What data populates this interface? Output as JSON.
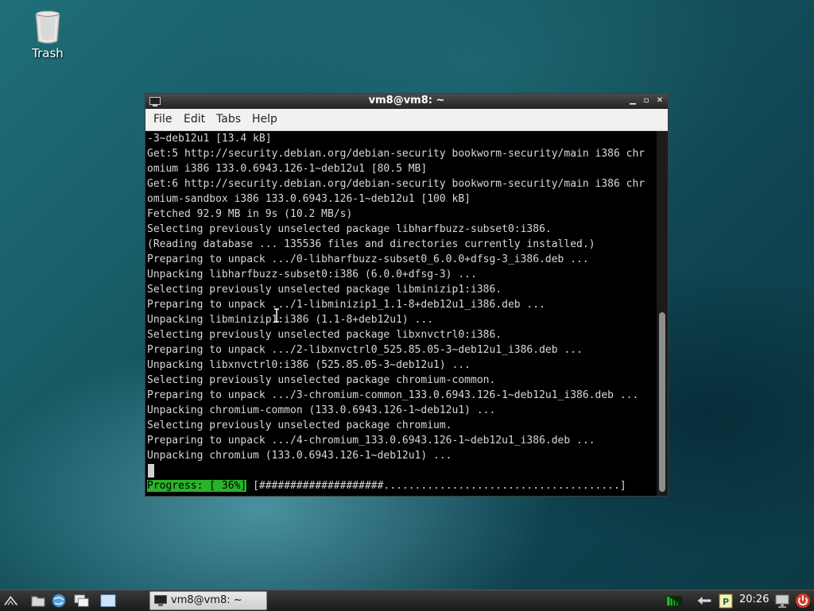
{
  "desktop": {
    "trash_label": "Trash"
  },
  "window": {
    "title": "vm8@vm8: ~",
    "menu": [
      "File",
      "Edit",
      "Tabs",
      "Help"
    ]
  },
  "terminal": {
    "lines": [
      "-3~deb12u1 [13.4 kB]",
      "Get:5 http://security.debian.org/debian-security bookworm-security/main i386 chr",
      "omium i386 133.0.6943.126-1~deb12u1 [80.5 MB]",
      "Get:6 http://security.debian.org/debian-security bookworm-security/main i386 chr",
      "omium-sandbox i386 133.0.6943.126-1~deb12u1 [100 kB]",
      "Fetched 92.9 MB in 9s (10.2 MB/s)",
      "Selecting previously unselected package libharfbuzz-subset0:i386.",
      "(Reading database ... 135536 files and directories currently installed.)",
      "Preparing to unpack .../0-libharfbuzz-subset0_6.0.0+dfsg-3_i386.deb ...",
      "Unpacking libharfbuzz-subset0:i386 (6.0.0+dfsg-3) ...",
      "Selecting previously unselected package libminizip1:i386.",
      "Preparing to unpack .../1-libminizip1_1.1-8+deb12u1_i386.deb ...",
      "Unpacking libminizip1:i386 (1.1-8+deb12u1) ...",
      "Selecting previously unselected package libxnvctrl0:i386.",
      "Preparing to unpack .../2-libxnvctrl0_525.85.05-3~deb12u1_i386.deb ...",
      "Unpacking libxnvctrl0:i386 (525.85.05-3~deb12u1) ...",
      "Selecting previously unselected package chromium-common.",
      "Preparing to unpack .../3-chromium-common_133.0.6943.126-1~deb12u1_i386.deb ...",
      "Unpacking chromium-common (133.0.6943.126-1~deb12u1) ...",
      "Selecting previously unselected package chromium.",
      "Preparing to unpack .../4-chromium_133.0.6943.126-1~deb12u1_i386.deb ...",
      "Unpacking chromium (133.0.6943.126-1~deb12u1) ..."
    ],
    "progress_label": "Progress: [ 36%]",
    "progress_bar": "[####################......................................]",
    "progress_percent": 36
  },
  "taskbar": {
    "task_title": "vm8@vm8: ~",
    "clock": "20:26"
  },
  "colors": {
    "progress_green": "#2ab22a",
    "terminal_bg": "#000000",
    "terminal_fg": "#d8d8d8"
  }
}
